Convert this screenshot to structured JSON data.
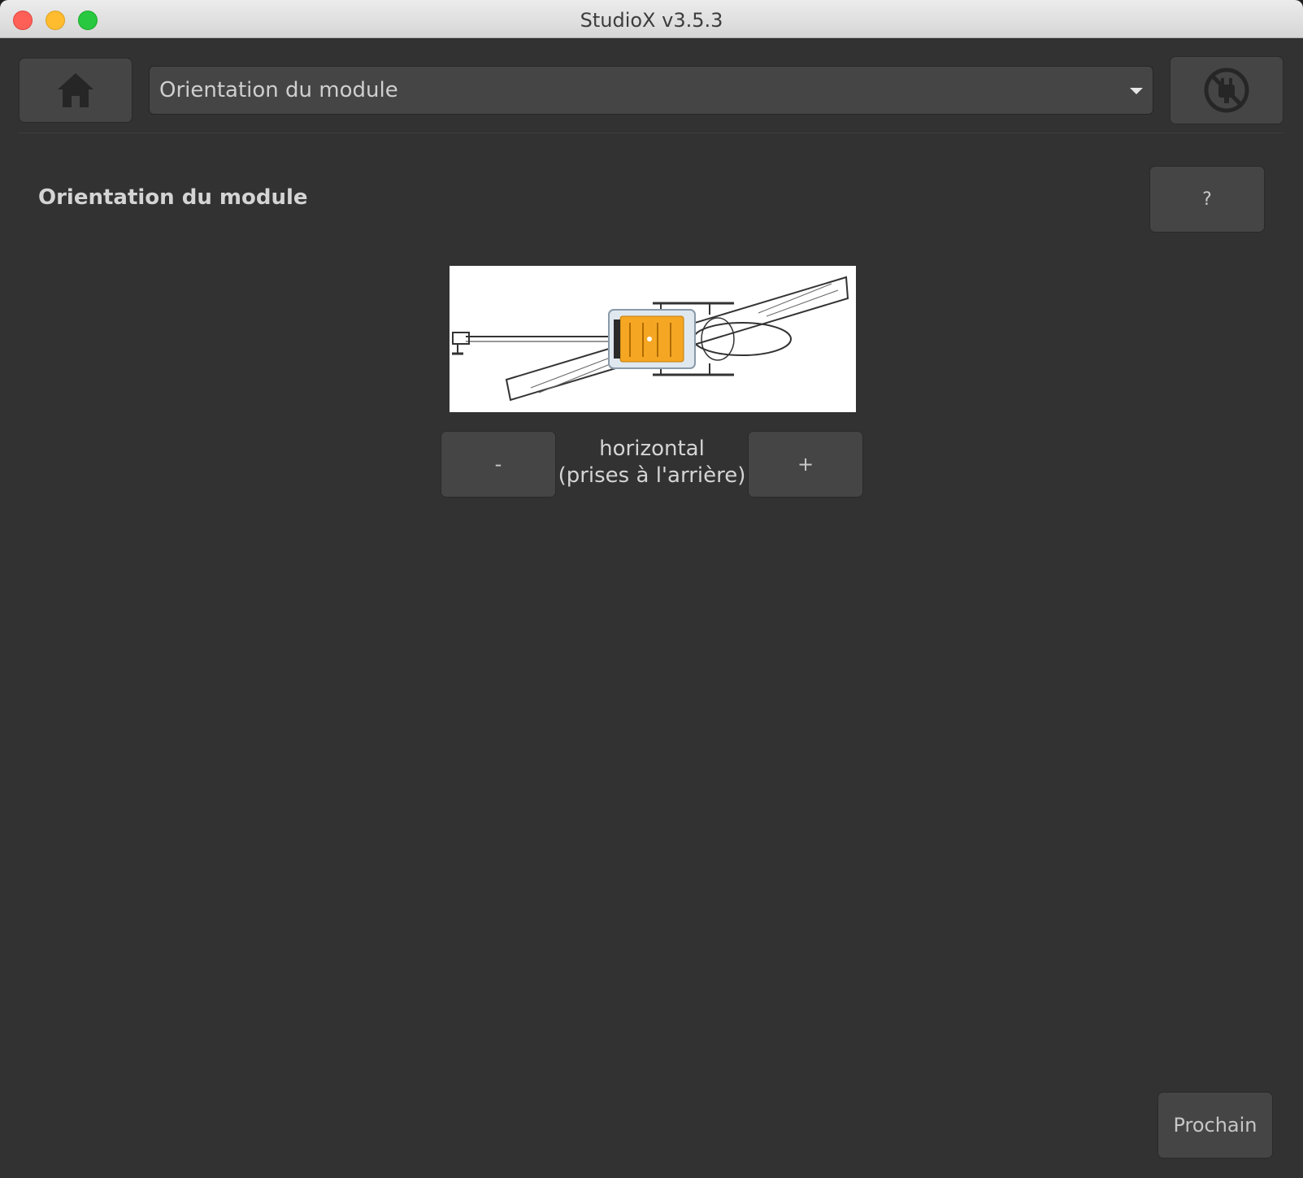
{
  "window": {
    "title": "StudioX v3.5.3"
  },
  "toolbar": {
    "home_icon": "home-icon",
    "page_select": {
      "selected": "Orientation du module"
    },
    "disconnect_icon": "disconnected-plug-icon"
  },
  "section": {
    "title": "Orientation du module",
    "help_label": "?"
  },
  "orientation": {
    "value_line1": "horizontal",
    "value_line2": "(prises à l'arrière)",
    "decrement_label": "-",
    "increment_label": "+",
    "module_color": "#f5a623"
  },
  "footer": {
    "next_label": "Prochain"
  }
}
